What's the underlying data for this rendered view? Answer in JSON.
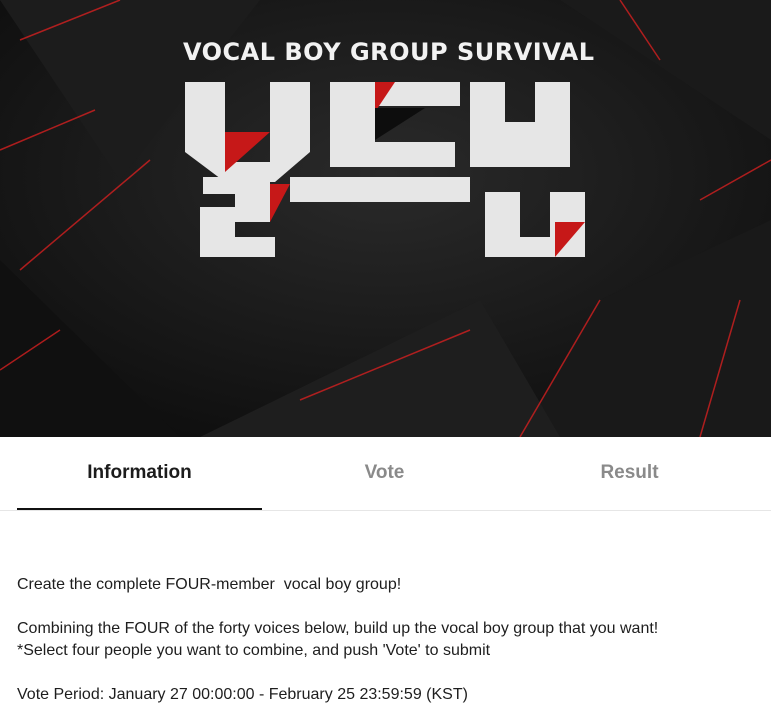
{
  "banner": {
    "subtitle": "VOCAL BOY GROUP SURVIVAL",
    "logo_label": "비드어 클럽",
    "colors": {
      "background": "#141414",
      "accent": "#e02020",
      "logo": "#e8e8e8"
    }
  },
  "tabs": [
    {
      "label": "Information",
      "active": true
    },
    {
      "label": "Vote",
      "active": false
    },
    {
      "label": "Result",
      "active": false
    }
  ],
  "info": {
    "headline": "Create the complete FOUR-member  vocal boy group!",
    "description": "Combining the FOUR of the forty voices below, build up the vocal boy group that you want!",
    "instruction": "*Select four people you want to combine, and push 'Vote' to submit",
    "period": "Vote Period: January 27 00:00:00 - February 25 23:59:59 (KST)"
  }
}
